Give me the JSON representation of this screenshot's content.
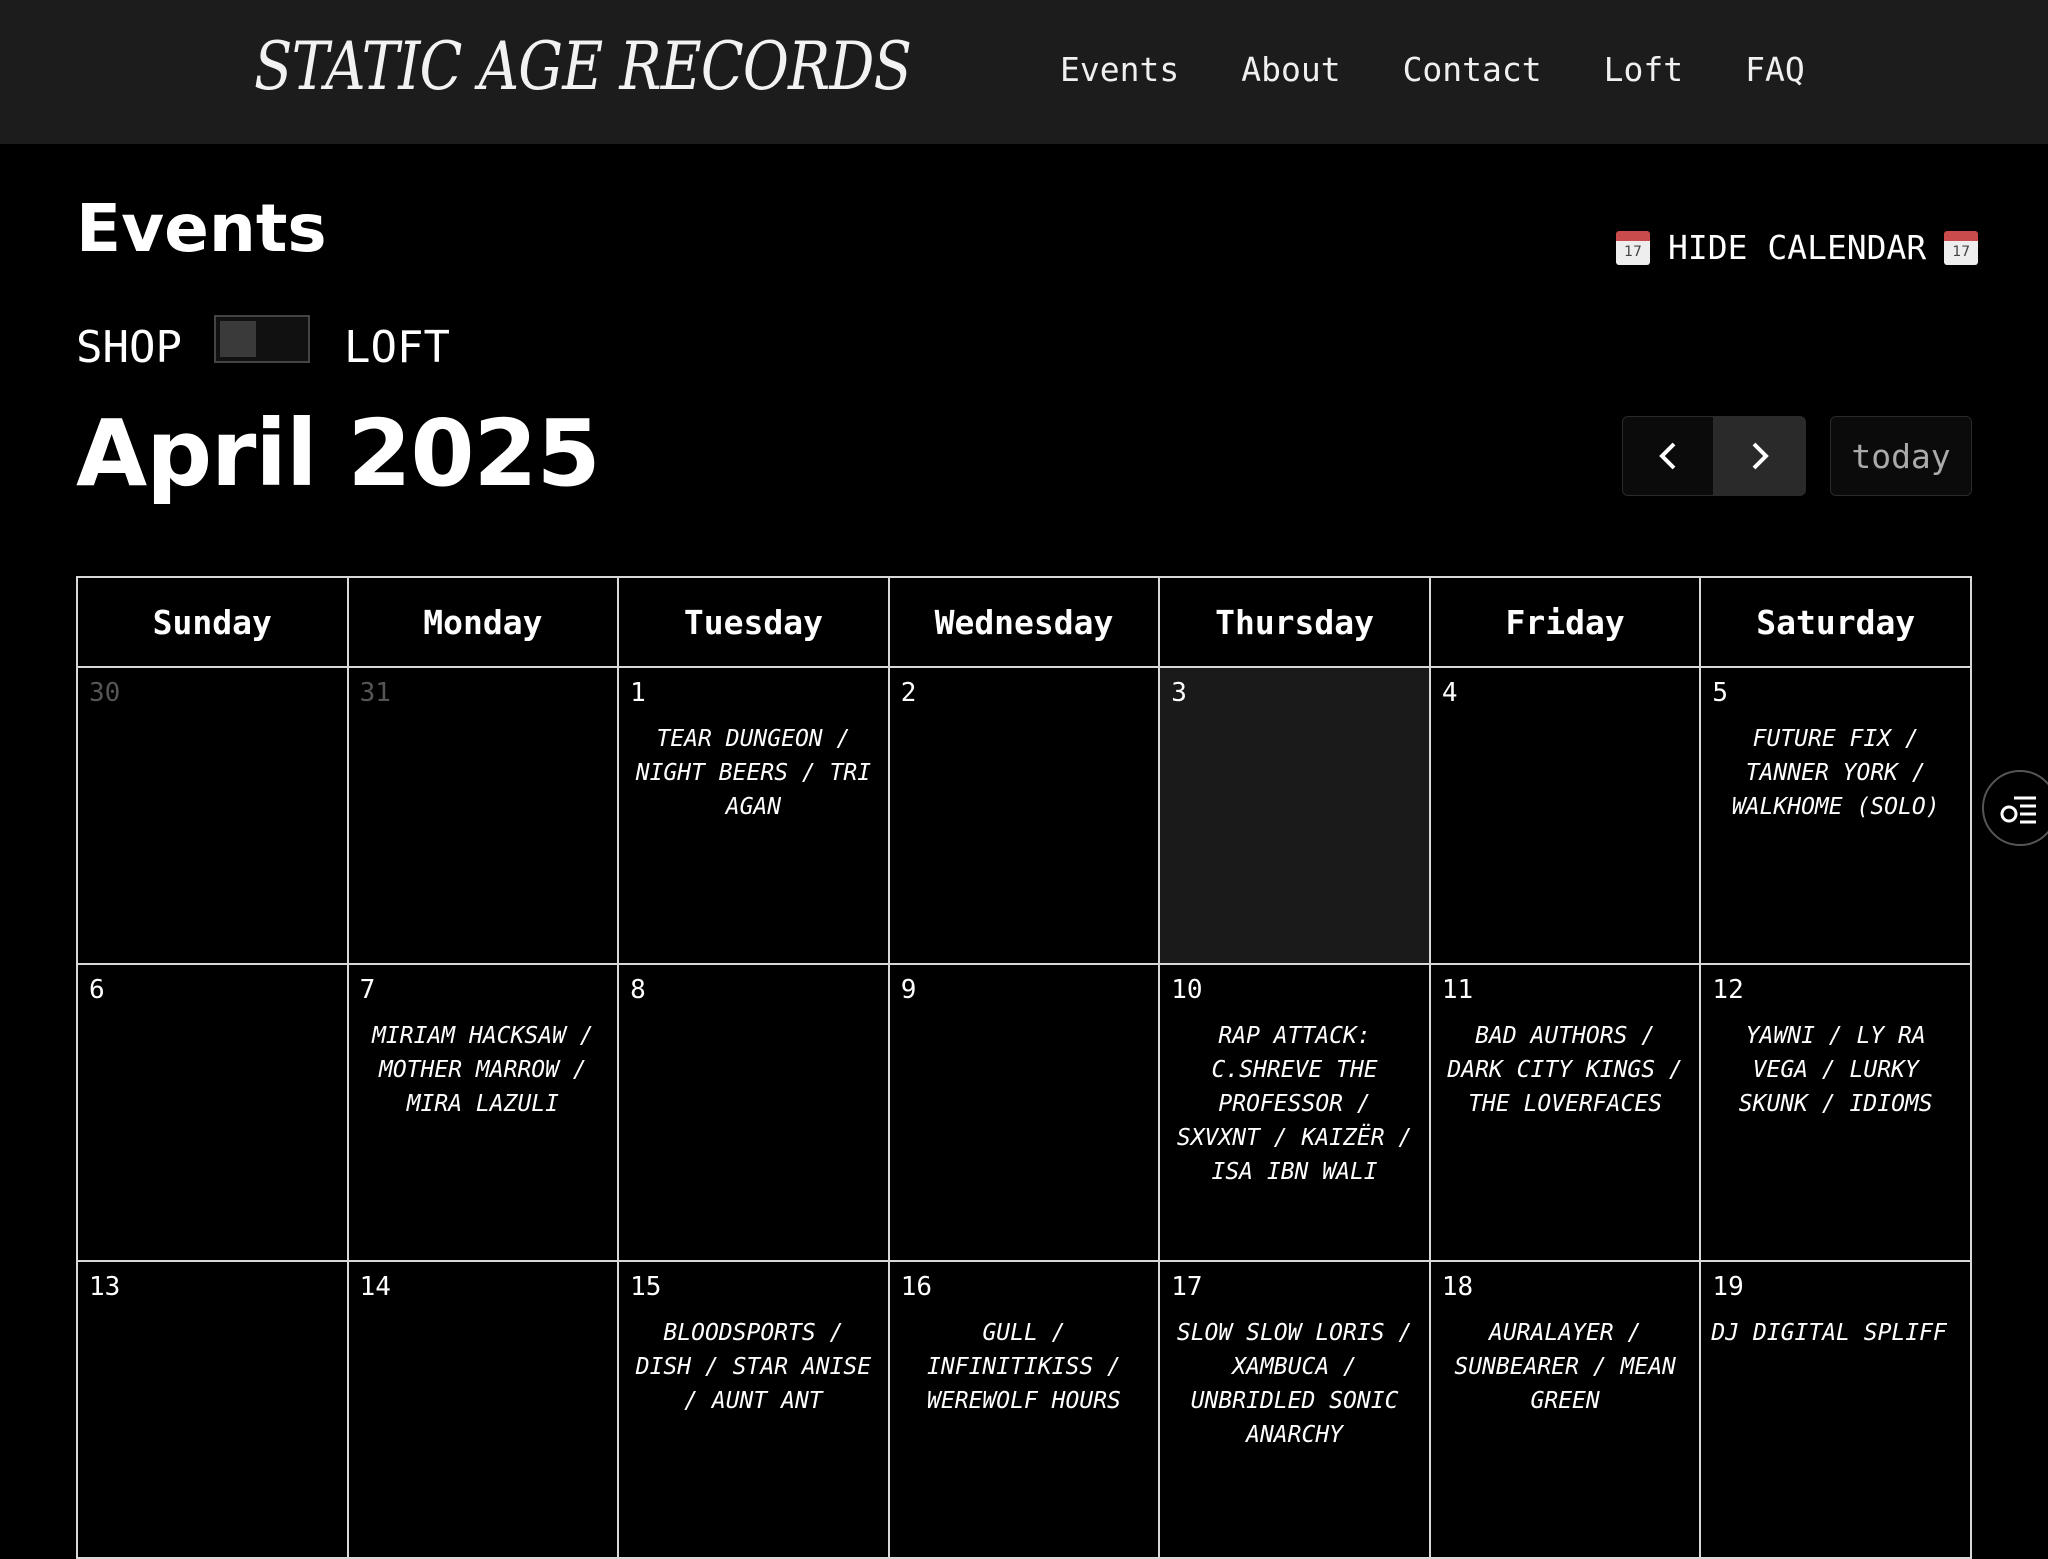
{
  "header": {
    "logo": "STATIC AGE RECORDS",
    "nav": [
      "Events",
      "About",
      "Contact",
      "Loft",
      "FAQ"
    ]
  },
  "page": {
    "title": "Events",
    "hide_calendar": "HIDE CALENDAR",
    "calendar_icon_day": "17",
    "toggle_left": "SHOP",
    "toggle_right": "LOFT",
    "month": "April 2025",
    "today_label": "today"
  },
  "calendar": {
    "weekdays": [
      "Sunday",
      "Monday",
      "Tuesday",
      "Wednesday",
      "Thursday",
      "Friday",
      "Saturday"
    ],
    "weeks": [
      [
        {
          "day": "30",
          "event": ""
        },
        {
          "day": "31",
          "event": ""
        },
        {
          "day": "1",
          "event": "TEAR DUNGEON / NIGHT BEERS / TRI AGAN"
        },
        {
          "day": "2",
          "event": ""
        },
        {
          "day": "3",
          "event": ""
        },
        {
          "day": "4",
          "event": ""
        },
        {
          "day": "5",
          "event": "FUTURE FIX / TANNER YORK / WALKHOME (SOLO)"
        }
      ],
      [
        {
          "day": "6",
          "event": ""
        },
        {
          "day": "7",
          "event": "MIRIAM HACKSAW / MOTHER MARROW / MIRA LAZULI"
        },
        {
          "day": "8",
          "event": ""
        },
        {
          "day": "9",
          "event": ""
        },
        {
          "day": "10",
          "event": "RAP ATTACK: C.SHREVE THE PROFESSOR / SXVXNT / KAIZËR / ISA IBN WALI"
        },
        {
          "day": "11",
          "event": "BAD AUTHORS / DARK CITY KINGS / THE LOVERFACES"
        },
        {
          "day": "12",
          "event": "YAWNI / LY RA VEGA / LURKY SKUNK / IDIOMS"
        }
      ],
      [
        {
          "day": "13",
          "event": ""
        },
        {
          "day": "14",
          "event": ""
        },
        {
          "day": "15",
          "event": "BLOODSPORTS / DISH / STAR ANISE / AUNT ANT"
        },
        {
          "day": "16",
          "event": "GULL / INFINITIKISS / WEREWOLF HOURS"
        },
        {
          "day": "17",
          "event": "SLOW SLOW LORIS / XAMBUCA / UNBRIDLED SONIC ANARCHY"
        },
        {
          "day": "18",
          "event": "AURALAYER / SUNBEARER / MEAN GREEN"
        },
        {
          "day": "19",
          "event": "DJ DIGITAL SPLIFF"
        }
      ]
    ]
  }
}
